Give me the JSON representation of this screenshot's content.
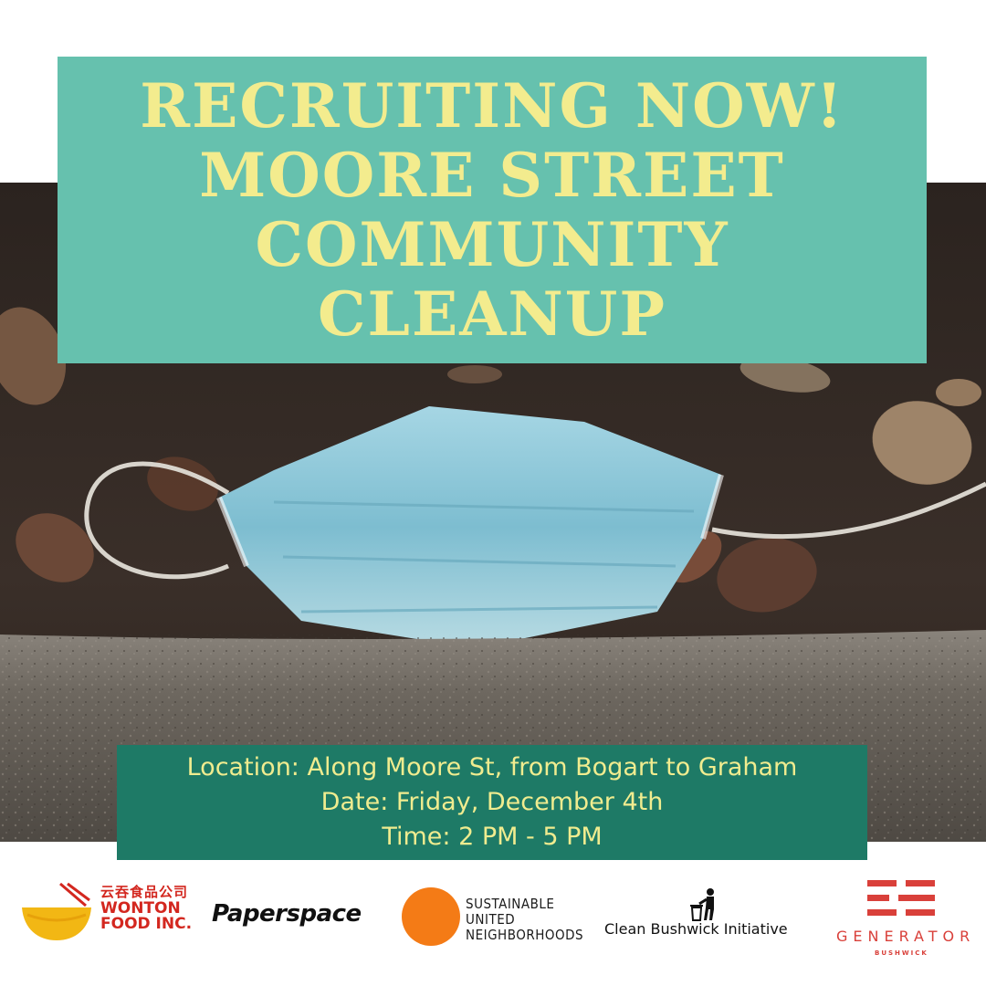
{
  "poster": {
    "title_lines": [
      "RECRUITING NOW!",
      "MOORE STREET",
      "COMMUNITY",
      "CLEANUP"
    ],
    "details": {
      "location": "Location: Along Moore St, from Bogart to Graham",
      "date": "Date: Friday, December 4th",
      "time": "Time: 2 PM - 5 PM"
    }
  },
  "sponsors": {
    "wonton": {
      "chinese": "云吞食品公司",
      "line1": "WONTON",
      "line2": "FOOD INC."
    },
    "paperspace": {
      "name": "Paperspace"
    },
    "sun": {
      "line1": "SUSTAINABLE",
      "line2": "UNITED",
      "line3": "NEIGHBORHOODS"
    },
    "cbi": {
      "name": "Clean Bushwick Initiative"
    },
    "generator": {
      "name": "GENERATOR",
      "sub": "BUSHWICK"
    }
  },
  "colors": {
    "title_box": "#66c1ae",
    "title_text": "#f3ec8e",
    "info_box": "#1e7a66",
    "info_text": "#f0ec8f",
    "mask": "#8cc7d9"
  }
}
